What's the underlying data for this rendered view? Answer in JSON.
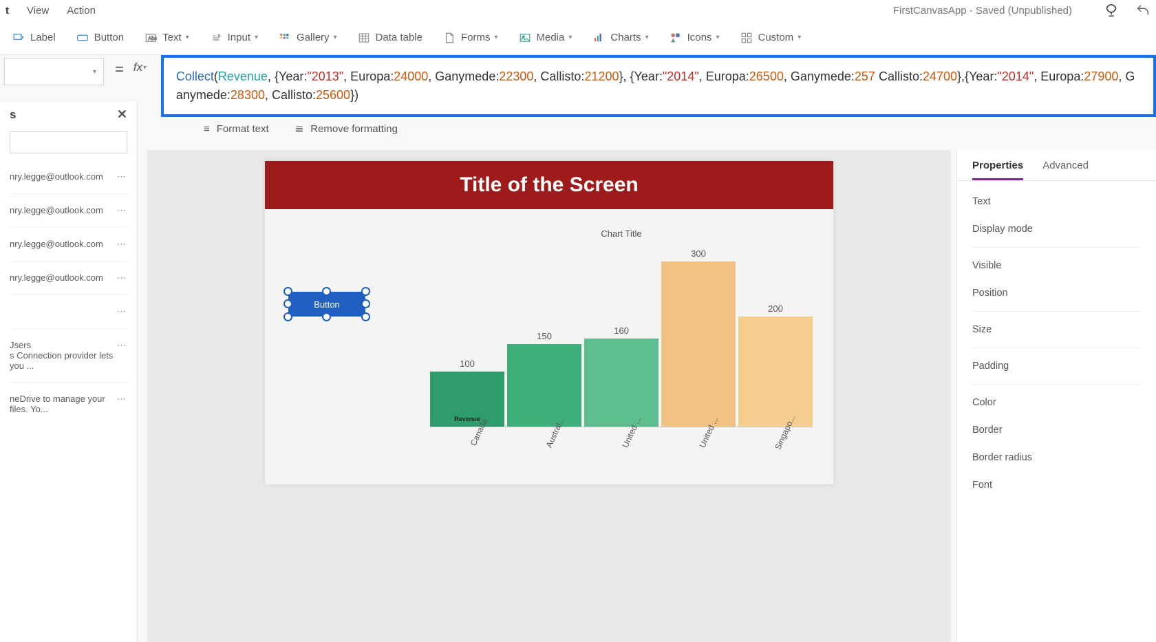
{
  "menu": {
    "items": [
      "t",
      "View",
      "Action"
    ]
  },
  "app_title": "FirstCanvasApp - Saved (Unpublished)",
  "ribbon": {
    "label": "Label",
    "button": "Button",
    "text": "Text",
    "input": "Input",
    "gallery": "Gallery",
    "datatable": "Data table",
    "forms": "Forms",
    "media": "Media",
    "charts": "Charts",
    "icons": "Icons",
    "custom": "Custom"
  },
  "equals": "=",
  "fx": "fx",
  "formula_tokens": [
    {
      "t": "fn",
      "v": "Collect"
    },
    {
      "t": "plain",
      "v": "("
    },
    {
      "t": "id",
      "v": "Revenue"
    },
    {
      "t": "plain",
      "v": ", {Year:"
    },
    {
      "t": "str",
      "v": "\"2013\""
    },
    {
      "t": "plain",
      "v": ", Europa:"
    },
    {
      "t": "num",
      "v": "24000"
    },
    {
      "t": "plain",
      "v": ", Ganymede:"
    },
    {
      "t": "num",
      "v": "22300"
    },
    {
      "t": "plain",
      "v": ", Callisto:"
    },
    {
      "t": "num",
      "v": "21200"
    },
    {
      "t": "plain",
      "v": "}, {Year:"
    },
    {
      "t": "str",
      "v": "\"2014\""
    },
    {
      "t": "plain",
      "v": ", Europa:"
    },
    {
      "t": "num",
      "v": "26500"
    },
    {
      "t": "plain",
      "v": ", Ganymede:"
    },
    {
      "t": "num",
      "v": "257"
    },
    {
      "t": "plain",
      "v": " Callisto:"
    },
    {
      "t": "num",
      "v": "24700"
    },
    {
      "t": "plain",
      "v": "},{Year:"
    },
    {
      "t": "str",
      "v": "\"2014\""
    },
    {
      "t": "plain",
      "v": ", Europa:"
    },
    {
      "t": "num",
      "v": "27900"
    },
    {
      "t": "plain",
      "v": ", Ganymede:"
    },
    {
      "t": "num",
      "v": "28300"
    },
    {
      "t": "plain",
      "v": ", Callisto:"
    },
    {
      "t": "num",
      "v": "25600"
    },
    {
      "t": "plain",
      "v": "})"
    }
  ],
  "format_text": "Format text",
  "remove_formatting": "Remove formatting",
  "left_panel": {
    "header": "s",
    "items": [
      "nry.legge@outlook.com",
      "nry.legge@outlook.com",
      "nry.legge@outlook.com",
      "nry.legge@outlook.com",
      "",
      "Jsers\ns Connection provider lets you ...",
      "neDrive to manage your files. Yo..."
    ]
  },
  "screen": {
    "title": "Title of the Screen",
    "button_label": "Button"
  },
  "chart_data": {
    "type": "bar",
    "title": "Chart Title",
    "categories": [
      "Canada",
      "Austral...",
      "United ...",
      "United ...",
      "Singapo..."
    ],
    "values": [
      100,
      150,
      160,
      300,
      200
    ],
    "ylim": [
      0,
      300
    ],
    "legend_inline": "Revenue",
    "colors": [
      "#2e9d6b",
      "#3fb07a",
      "#5fbe8e",
      "#f2c283",
      "#f4cd8f"
    ]
  },
  "properties": {
    "tabs": [
      "Properties",
      "Advanced"
    ],
    "active_tab": 0,
    "groups": [
      [
        "Text",
        "Display mode"
      ],
      [
        "Visible",
        "Position"
      ],
      [
        "Size"
      ],
      [
        "Padding"
      ],
      [
        "Color",
        "Border",
        "Border radius",
        "Font"
      ]
    ]
  }
}
